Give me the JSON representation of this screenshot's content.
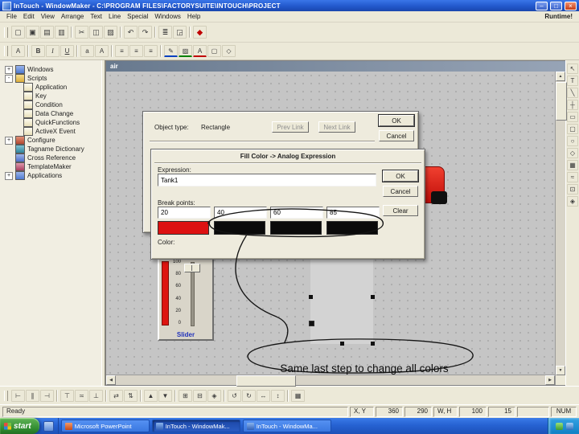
{
  "titlebar": {
    "title": "InTouch - WindowMaker - C:\\PROGRAM FILES\\FACTORYSUITE\\INTOUCH\\PROJECT",
    "minimize": "–",
    "maximize": "□",
    "close": "×"
  },
  "menubar": {
    "items": [
      "File",
      "Edit",
      "View",
      "Arrange",
      "Text",
      "Line",
      "Special",
      "Windows",
      "Help"
    ],
    "runtime": "Runtime!"
  },
  "toolbar_top": [
    {
      "name": "new-window-icon",
      "glyph": "▢"
    },
    {
      "name": "open-window-icon",
      "glyph": "▣"
    },
    {
      "name": "save-window-icon",
      "glyph": "▤"
    },
    {
      "name": "save-all-icon",
      "glyph": "▥"
    },
    {
      "name": "toolbar-separator",
      "glyph": ""
    },
    {
      "name": "cut-icon",
      "glyph": "✂"
    },
    {
      "name": "copy-icon",
      "glyph": "◫"
    },
    {
      "name": "paste-icon",
      "glyph": "▨"
    },
    {
      "name": "toolbar-separator",
      "glyph": ""
    },
    {
      "name": "undo-icon",
      "glyph": "↶"
    },
    {
      "name": "redo-icon",
      "glyph": "↷"
    },
    {
      "name": "toolbar-separator",
      "glyph": ""
    },
    {
      "name": "print-icon",
      "glyph": "≣"
    },
    {
      "name": "print-preview-icon",
      "glyph": "◲"
    },
    {
      "name": "toolbar-separator",
      "glyph": ""
    },
    {
      "name": "wizard-icon",
      "glyph": "◆"
    }
  ],
  "toolbar_format": [
    {
      "name": "font-icon",
      "glyph": "A"
    },
    {
      "name": "toolbar-separator",
      "glyph": ""
    },
    {
      "name": "bold-icon",
      "glyph": "B"
    },
    {
      "name": "italic-icon",
      "glyph": "I"
    },
    {
      "name": "underline-icon",
      "glyph": "U"
    },
    {
      "name": "toolbar-separator",
      "glyph": ""
    },
    {
      "name": "font-smaller-icon",
      "glyph": "a"
    },
    {
      "name": "font-bigger-icon",
      "glyph": "A"
    },
    {
      "name": "toolbar-separator",
      "glyph": ""
    },
    {
      "name": "align-left-icon",
      "glyph": "≡"
    },
    {
      "name": "align-center-icon",
      "glyph": "≡"
    },
    {
      "name": "align-right-icon",
      "glyph": "≡"
    },
    {
      "name": "toolbar-separator",
      "glyph": ""
    },
    {
      "name": "line-color-icon",
      "glyph": "✎"
    },
    {
      "name": "fill-color-icon",
      "glyph": "▨"
    },
    {
      "name": "text-color-icon",
      "glyph": "A"
    },
    {
      "name": "window-color-icon",
      "glyph": "▢"
    },
    {
      "name": "transparent-color-icon",
      "glyph": "◇"
    }
  ],
  "toolbar_bottom": [
    {
      "name": "align-left-icon",
      "glyph": "⊢"
    },
    {
      "name": "align-center-icon",
      "glyph": "∥"
    },
    {
      "name": "align-right-icon",
      "glyph": "⊣"
    },
    {
      "name": "toolbar-separator",
      "glyph": ""
    },
    {
      "name": "align-top-icon",
      "glyph": "⊤"
    },
    {
      "name": "align-middle-icon",
      "glyph": "≍"
    },
    {
      "name": "align-bottom-icon",
      "glyph": "⊥"
    },
    {
      "name": "toolbar-separator",
      "glyph": ""
    },
    {
      "name": "space-horizontal-icon",
      "glyph": "⇄"
    },
    {
      "name": "space-vertical-icon",
      "glyph": "⇅"
    },
    {
      "name": "toolbar-separator",
      "glyph": ""
    },
    {
      "name": "bring-to-front-icon",
      "glyph": "▲"
    },
    {
      "name": "send-to-back-icon",
      "glyph": "▼"
    },
    {
      "name": "toolbar-separator",
      "glyph": ""
    },
    {
      "name": "group-icon",
      "glyph": "⊞"
    },
    {
      "name": "ungroup-icon",
      "glyph": "⊟"
    },
    {
      "name": "make-symbol-icon",
      "glyph": "◈"
    },
    {
      "name": "toolbar-separator",
      "glyph": ""
    },
    {
      "name": "rotate-ccw-icon",
      "glyph": "↺"
    },
    {
      "name": "rotate-cw-icon",
      "glyph": "↻"
    },
    {
      "name": "flip-horizontal-icon",
      "glyph": "↔"
    },
    {
      "name": "flip-vertical-icon",
      "glyph": "↕"
    },
    {
      "name": "toolbar-separator",
      "glyph": ""
    },
    {
      "name": "snap-grid-icon",
      "glyph": "▦"
    }
  ],
  "tool_palette": [
    {
      "name": "select-tool-icon",
      "glyph": "↖"
    },
    {
      "name": "text-tool-icon",
      "glyph": "T"
    },
    {
      "name": "line-tool-icon",
      "glyph": "╲"
    },
    {
      "name": "hv-line-tool-icon",
      "glyph": "┼"
    },
    {
      "name": "rectangle-tool-icon",
      "glyph": "▭"
    },
    {
      "name": "rounded-rectangle-tool-icon",
      "glyph": "▢"
    },
    {
      "name": "ellipse-tool-icon",
      "glyph": "○"
    },
    {
      "name": "polygon-tool-icon",
      "glyph": "◇"
    },
    {
      "name": "bitmap-tool-icon",
      "glyph": "▦"
    },
    {
      "name": "trend-tool-icon",
      "glyph": "≈"
    },
    {
      "name": "button-tool-icon",
      "glyph": "⊡"
    },
    {
      "name": "symbol-tool-icon",
      "glyph": "◈"
    }
  ],
  "tree": {
    "items": [
      {
        "label": "Windows",
        "expander": "+"
      },
      {
        "label": "Scripts",
        "expander": "-"
      },
      {
        "label": "Application"
      },
      {
        "label": "Key"
      },
      {
        "label": "Condition"
      },
      {
        "label": "Data Change"
      },
      {
        "label": "QuickFunctions"
      },
      {
        "label": "ActiveX Event"
      },
      {
        "label": "Configure",
        "expander": "+"
      },
      {
        "label": "Tagname Dictionary"
      },
      {
        "label": "Cross Reference"
      },
      {
        "label": "TemplateMaker"
      },
      {
        "label": "Applications",
        "expander": "+"
      }
    ]
  },
  "air_window": {
    "title": "air"
  },
  "link_dialog": {
    "object_type_label": "Object type:",
    "object_type_value": "Rectangle",
    "prev_link_label": "Prev Link",
    "next_link_label": "Next Link",
    "ok_label": "OK",
    "cancel_label": "Cancel"
  },
  "fill_color_dialog": {
    "title": "Fill Color -> Analog Expression",
    "expression_label": "Expression:",
    "expression_value": "Tank1",
    "break_points_label": "Break points:",
    "break_points": [
      "20",
      "40",
      "60",
      "85"
    ],
    "color_label": "Color:",
    "ok_label": "OK",
    "cancel_label": "Cancel",
    "clear_label": "Clear",
    "swatch_colors": [
      "#dd1111",
      "#0a0a0a",
      "#0a0a0a",
      "#0a0a0a"
    ]
  },
  "slider": {
    "ticks": [
      "100",
      "80",
      "60",
      "40",
      "20",
      "0"
    ],
    "label": "Slider"
  },
  "annotation": "Same last step to change all colors",
  "statusbar": {
    "ready": "Ready",
    "xy_label": "X, Y",
    "x": "360",
    "y": "290",
    "wh_label": "W, H",
    "w": "100",
    "h": "15",
    "num": "NUM"
  },
  "taskbar": {
    "start_label": "start",
    "buttons": [
      {
        "label": "Microsoft PowerPoint"
      },
      {
        "label": "InTouch - WindowMak..."
      },
      {
        "label": "InTouch - WindowMa..."
      }
    ]
  }
}
